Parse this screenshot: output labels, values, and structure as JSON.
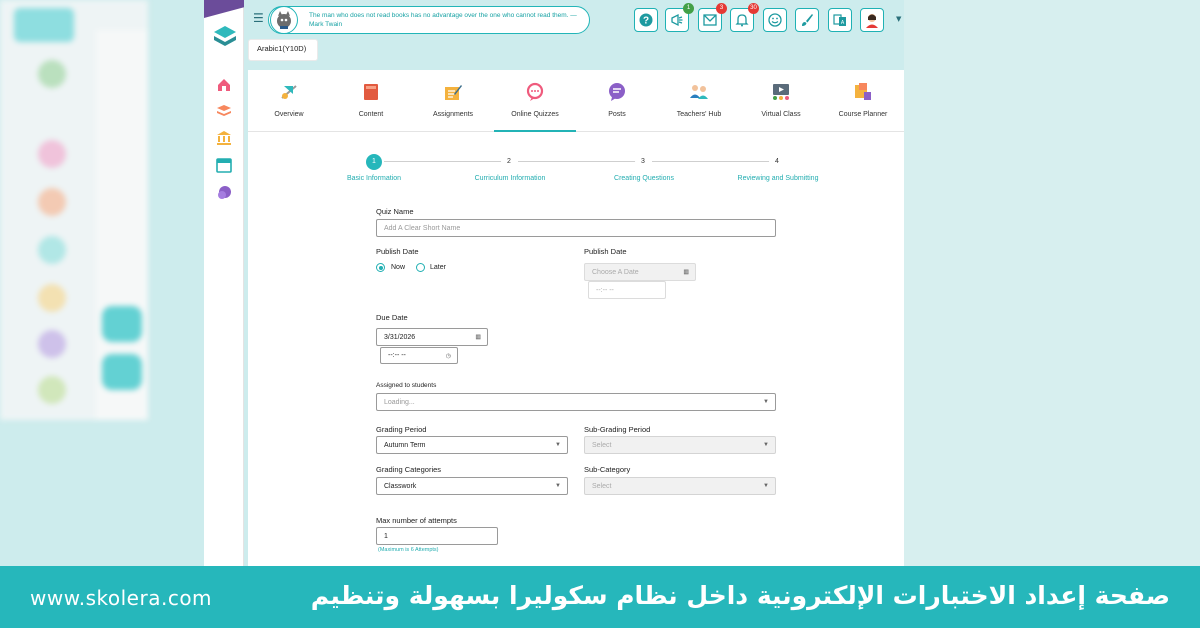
{
  "topbar": {
    "quote": "The man who does not read books has no advantage over the one who cannot read them. — Mark Twain",
    "badges": {
      "announcements": "1",
      "messages": "3",
      "notifications": "30"
    }
  },
  "course": {
    "chip": "Arabic1(Y10D)"
  },
  "tabs": [
    {
      "label": "Overview",
      "icon": "overview-icon"
    },
    {
      "label": "Content",
      "icon": "book-icon"
    },
    {
      "label": "Assignments",
      "icon": "assignment-icon"
    },
    {
      "label": "Online Quizzes",
      "icon": "quiz-icon",
      "active": true
    },
    {
      "label": "Posts",
      "icon": "chat-bubble-icon"
    },
    {
      "label": "Teachers' Hub",
      "icon": "teachers-icon"
    },
    {
      "label": "Virtual Class",
      "icon": "virtual-class-icon"
    },
    {
      "label": "Course Planner",
      "icon": "planner-icon"
    }
  ],
  "steps": [
    {
      "number": "1",
      "label": "Basic Information",
      "active": true
    },
    {
      "number": "2",
      "label": "Curriculum Information"
    },
    {
      "number": "3",
      "label": "Creating Questions"
    },
    {
      "number": "4",
      "label": "Reviewing and Submitting"
    }
  ],
  "form": {
    "quiz_name_label": "Quiz Name",
    "quiz_name_placeholder": "Add A Clear Short Name",
    "publish_date_label": "Publish Date",
    "publish_now": "Now",
    "publish_later": "Later",
    "publish_date_label_2": "Publish Date",
    "publish_date_placeholder": "Choose A Date",
    "publish_time_value": "--:-- --",
    "due_date_label": "Due Date",
    "due_date_value": "3/31/2026",
    "due_time_value": "--:-- --",
    "assigned_label": "Assigned to students",
    "assigned_value": "Loading...",
    "grading_period_label": "Grading Period",
    "grading_period_value": "Autumn Term",
    "sub_grading_period_label": "Sub-Grading Period",
    "sub_grading_period_value": "Select",
    "grading_categories_label": "Grading Categories",
    "grading_categories_value": "Classwork",
    "sub_category_label": "Sub-Category",
    "sub_category_value": "Select",
    "max_attempts_label": "Max number of attempts",
    "max_attempts_value": "1",
    "max_attempts_hint": "(Maximum is 6 Attempts)"
  },
  "banner": {
    "url": "www.skolera.com",
    "title": "صفحة إعداد الاختبارات الإلكترونية داخل نظام سكوليرا بسهولة وتنظيم"
  },
  "colors": {
    "accent": "#26b7bb",
    "rail_top": "#6b4c9a",
    "badge_red": "#e53935",
    "badge_green": "#43a047"
  }
}
